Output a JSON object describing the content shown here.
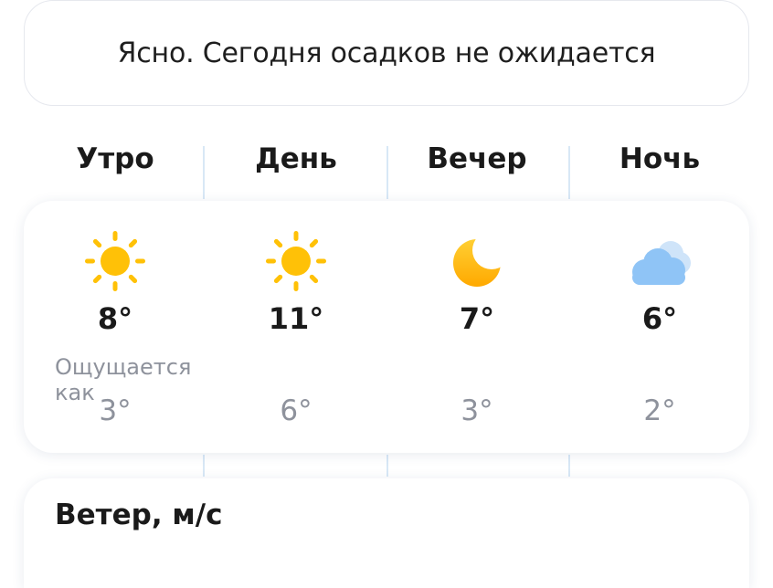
{
  "summary": {
    "text": "Ясно. Сегодня осадков не ожидается"
  },
  "periods": [
    {
      "label": "Утро",
      "icon": "sun-icon",
      "temp": "8°",
      "feels": "3°"
    },
    {
      "label": "День",
      "icon": "sun-icon",
      "temp": "11°",
      "feels": "6°"
    },
    {
      "label": "Вечер",
      "icon": "moon-icon",
      "temp": "7°",
      "feels": "3°"
    },
    {
      "label": "Ночь",
      "icon": "cloud-icon",
      "temp": "6°",
      "feels": "2°"
    }
  ],
  "feels_like_label": "Ощущается как",
  "wind": {
    "title": "Ветер, м/с"
  },
  "colors": {
    "sun": "#ffc107",
    "moon": "#ffb300",
    "cloud": "#8fc4f6",
    "muted_text": "#8e929c",
    "divider": "#d8e8f6"
  }
}
